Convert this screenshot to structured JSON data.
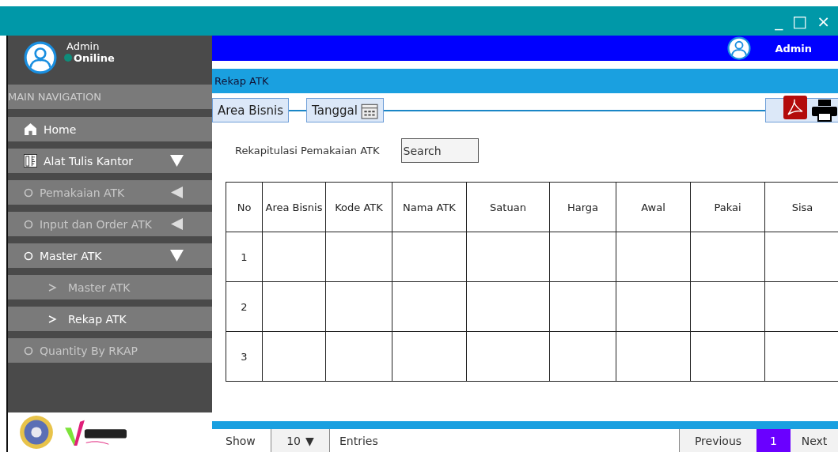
{
  "window": {
    "controls": [
      "_",
      "□",
      "×"
    ]
  },
  "user_panel": {
    "name": "Admin",
    "status": "Oniline"
  },
  "sidebar": {
    "header": "MAIN NAVIGATION",
    "items": [
      {
        "label": "Home",
        "kind": "home",
        "highlighted": true
      },
      {
        "label": "Alat Tulis Kantor",
        "kind": "tools",
        "highlighted": true,
        "expanded": true
      },
      {
        "label": "Pemakaian ATK",
        "kind": "circle",
        "highlighted": false,
        "expanded": false
      },
      {
        "label": "Input dan Order ATK",
        "kind": "circle",
        "highlighted": false,
        "expanded": false
      },
      {
        "label": "Master ATK",
        "kind": "circle",
        "highlighted": true,
        "expanded": true
      },
      {
        "label": "Master ATK",
        "kind": "chevron",
        "highlighted": false
      },
      {
        "label": "Rekap ATK",
        "kind": "chevron",
        "highlighted": true
      },
      {
        "label": "Quantity By RKAP",
        "kind": "circle",
        "highlighted": false
      }
    ]
  },
  "top_bar": {
    "user": "Admin"
  },
  "page_title": "Rekap ATK",
  "filters": [
    {
      "label": "Area Bisnis",
      "kind": "text"
    },
    {
      "label": "Tanggal",
      "kind": "date"
    }
  ],
  "report_title": "Rekapitulasi Pemakaian ATK",
  "search": {
    "placeholder": "Search"
  },
  "table": {
    "columns": [
      "No",
      "Area Bisnis",
      "Kode ATK",
      "Nama ATK",
      "Satuan",
      "Harga",
      "Awal",
      "Pakai",
      "Sisa"
    ],
    "rows": [
      [
        "1"
      ],
      [
        "2"
      ],
      [
        "3"
      ]
    ]
  },
  "footer": {
    "show": "Show",
    "page_size": "10",
    "dropdown": "▼",
    "entries": "Entries",
    "previous": "Previous",
    "pages": [
      {
        "label": "1",
        "selected": true
      }
    ],
    "next": "Next"
  }
}
